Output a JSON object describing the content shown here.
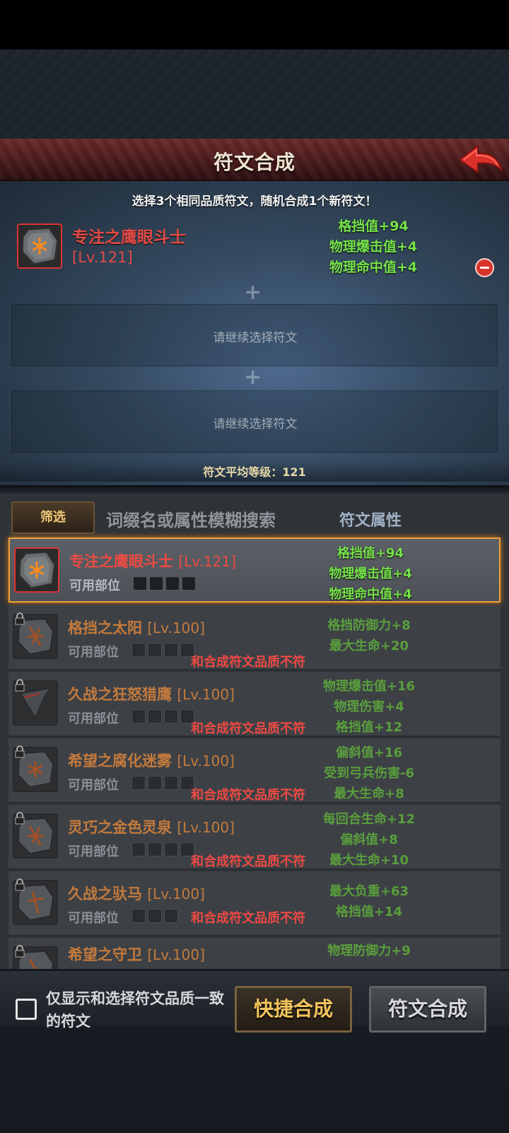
{
  "header": {
    "title": "符文合成"
  },
  "instruction": "选择3个相同品质符文，随机合成1个新符文！",
  "selected_slot": {
    "name": "专注之鹰眼斗士",
    "level": "[Lv.121]",
    "attrs": [
      "格挡值+94",
      "物理爆击值+4",
      "物理命中值+4"
    ]
  },
  "empty_slots": [
    "请继续选择符文",
    "请继续选择符文"
  ],
  "plus_symbol": "+",
  "average_level": "符文平均等级：121",
  "list": {
    "filter_label": "筛选",
    "search_placeholder": "词缀名或属性模糊搜索",
    "attr_header": "符文属性",
    "parts_label": "可用部位",
    "warning": "和合成符文品质不符",
    "rows": [
      {
        "name": "专注之鹰眼斗士",
        "level": "[Lv.121]",
        "attrs": [
          "格挡值+94",
          "物理爆击值+4",
          "物理命中值+4"
        ],
        "state": "selected"
      },
      {
        "name": "格挡之太阳",
        "level": "[Lv.100]",
        "attrs": [
          "格挡防御力+8",
          "最大生命+20"
        ],
        "state": "disabled"
      },
      {
        "name": "久战之狂怒猎鹰",
        "level": "[Lv.100]",
        "attrs": [
          "物理爆击值+16",
          "物理伤害+4",
          "格挡值+12"
        ],
        "state": "disabled"
      },
      {
        "name": "希望之腐化迷雾",
        "level": "[Lv.100]",
        "attrs": [
          "偏斜值+16",
          "受到弓兵伤害-6",
          "最大生命+8"
        ],
        "state": "disabled"
      },
      {
        "name": "灵巧之金色灵泉",
        "level": "[Lv.100]",
        "attrs": [
          "每回合生命+12",
          "偏斜值+8",
          "最大生命+10"
        ],
        "state": "disabled"
      },
      {
        "name": "久战之驮马",
        "level": "[Lv.100]",
        "attrs": [
          "最大负重+63",
          "格挡值+14"
        ],
        "state": "disabled"
      },
      {
        "name": "希望之守卫",
        "level": "[Lv.100]",
        "attrs": [
          "物理防御力+9"
        ],
        "state": "disabled"
      }
    ]
  },
  "bottom": {
    "checkbox_label": "仅显示和选择符文品质一致的符文",
    "quick_button": "快捷合成",
    "compose_button": "符文合成"
  },
  "colors": {
    "accent_red": "#e14b45",
    "attr_green": "#76e24a",
    "gold": "#f2c35c"
  }
}
